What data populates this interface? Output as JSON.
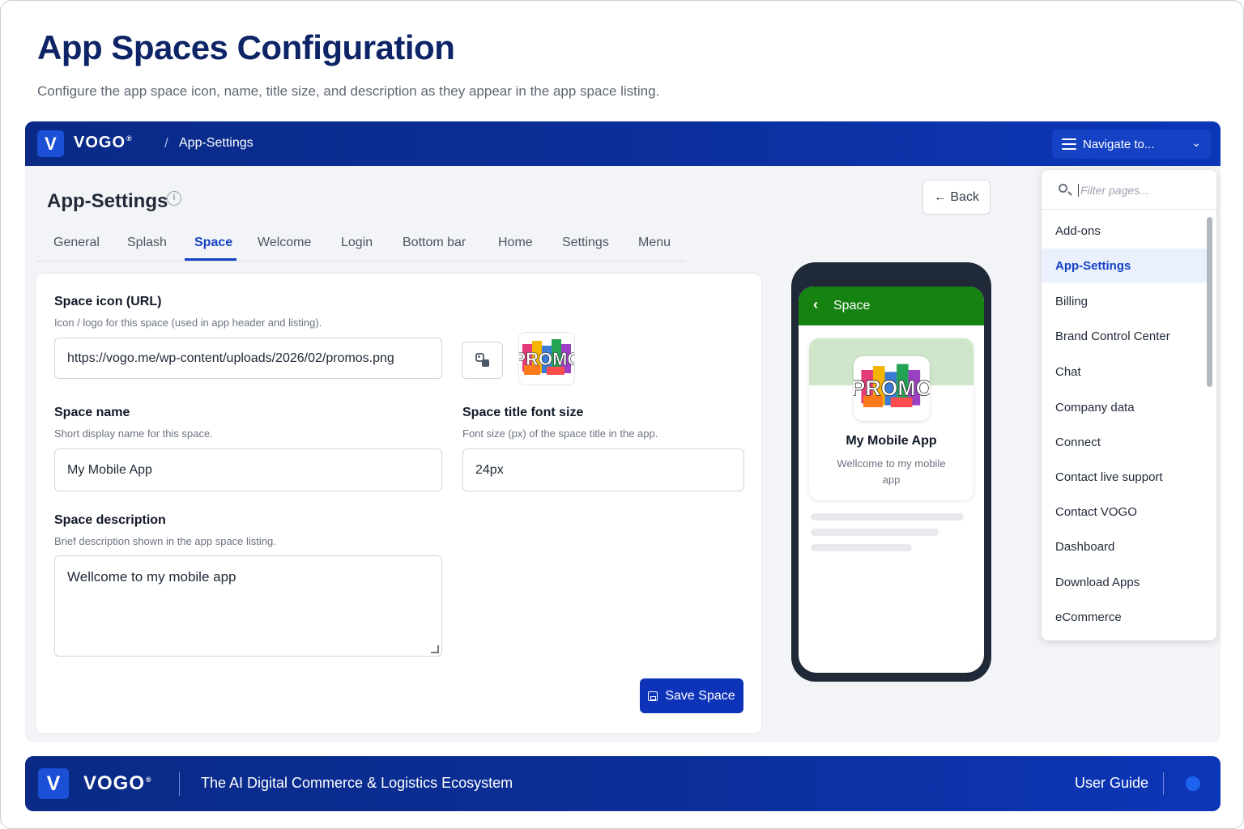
{
  "page": {
    "title": "App Spaces Configuration",
    "subtitle": "Configure the app space icon, name, title size, and description as they appear in the app space listing."
  },
  "topbar": {
    "logo_letter": "V",
    "brand": "VOGO",
    "brand_mark": "®",
    "crumb_sep": "/",
    "crumb": "App-Settings",
    "navigate_label": "Navigate to...",
    "navigate_chevron": "⌄"
  },
  "header": {
    "section_title": "App-Settings",
    "info_glyph": "i",
    "back_label": "← Back"
  },
  "tabs": [
    {
      "label": "General"
    },
    {
      "label": "Splash"
    },
    {
      "label": "Space",
      "active": true
    },
    {
      "label": "Welcome"
    },
    {
      "label": "Login"
    },
    {
      "label": "Bottom bar"
    },
    {
      "label": "Home"
    },
    {
      "label": "Settings"
    },
    {
      "label": "Menu"
    }
  ],
  "form": {
    "icon_label": "Space icon (URL)",
    "icon_help": "Icon / logo for this space (used in app header and listing).",
    "icon_value": "https://vogo.me/wp-content/uploads/2026/02/promos.png",
    "name_label": "Space name",
    "name_help": "Short display name for this space.",
    "name_value": "My Mobile App",
    "font_label": "Space title font size",
    "font_help": "Font size (px) of the space title in the app.",
    "font_value": "24px",
    "desc_label": "Space description",
    "desc_help": "Brief description shown in the app space listing.",
    "desc_value": "Wellcome to my mobile app",
    "save_label": "Save Space"
  },
  "preview": {
    "back_glyph": "‹",
    "header_title": "Space",
    "header_color": "#168212",
    "name": "My Mobile App",
    "desc": "Wellcome to my mobile app"
  },
  "navigate_menu": {
    "filter_placeholder": "Filter pages...",
    "items": [
      {
        "label": "Add-ons"
      },
      {
        "label": "App-Settings",
        "active": true
      },
      {
        "label": "Billing"
      },
      {
        "label": "Brand Control Center"
      },
      {
        "label": "Chat"
      },
      {
        "label": "Company data"
      },
      {
        "label": "Connect"
      },
      {
        "label": "Contact live support"
      },
      {
        "label": "Contact VOGO"
      },
      {
        "label": "Dashboard"
      },
      {
        "label": "Download Apps"
      },
      {
        "label": "eCommerce"
      }
    ]
  },
  "footer": {
    "logo_letter": "V",
    "brand": "VOGO",
    "brand_mark": "®",
    "tagline": "The AI Digital Commerce & Logistics Ecosystem",
    "user_guide": "User Guide"
  },
  "colors": {
    "brand_navy": "#0a2a86",
    "accent_blue": "#1542c4",
    "app_green": "#168212"
  }
}
